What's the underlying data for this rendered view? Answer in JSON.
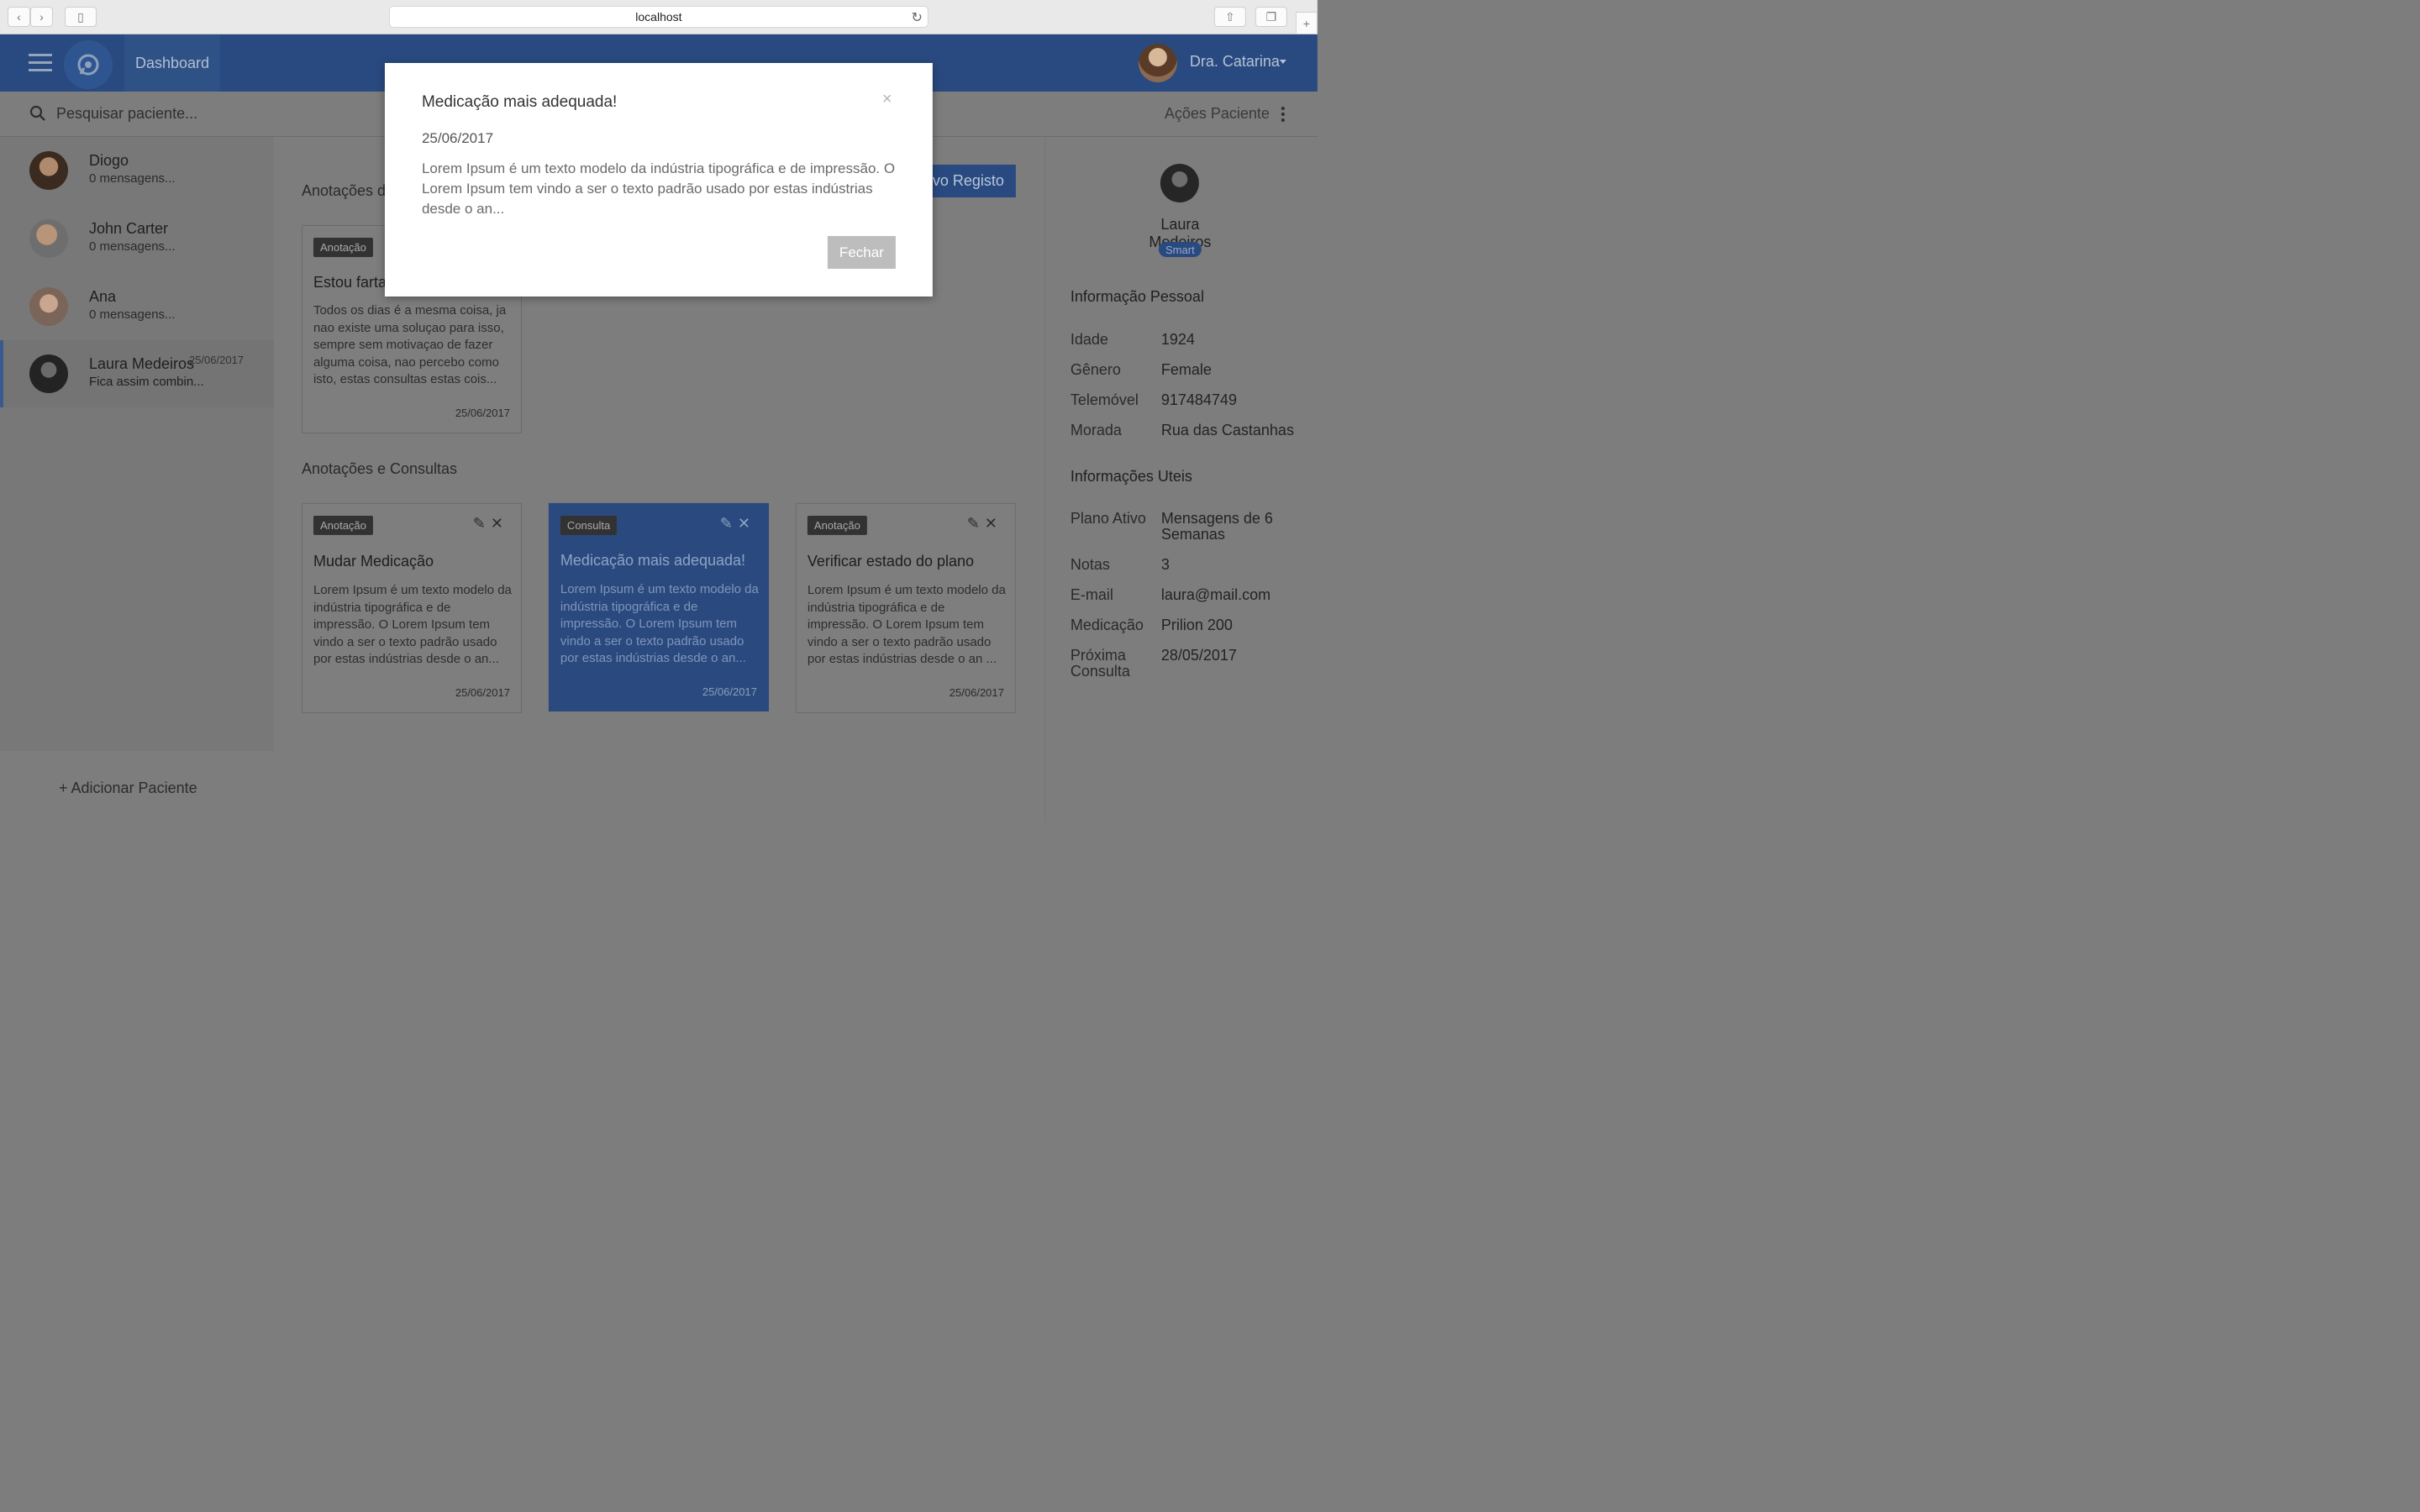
{
  "browser": {
    "url": "localhost"
  },
  "header": {
    "dashboard_label": "Dashboard",
    "user_name": "Dra. Catarina"
  },
  "search": {
    "placeholder": "Pesquisar paciente...",
    "actions_label": "Ações Paciente"
  },
  "patients": [
    {
      "name": "Diogo",
      "message": "0 mensagens...",
      "date": ""
    },
    {
      "name": "John Carter",
      "message": "0 mensagens...",
      "date": ""
    },
    {
      "name": "Ana",
      "message": "0 mensagens...",
      "date": ""
    },
    {
      "name": "Laura Medeiros",
      "message": "Fica assim combin...",
      "date": "25/06/2017"
    }
  ],
  "add_patient_label": "Adicionar Paciente",
  "main": {
    "pinned_title": "Anotações d",
    "new_record_label": "ovo Registo",
    "pinned_card": {
      "badge": "Anotação",
      "title": "Estou farta",
      "body": "Todos os dias é a mesma coisa, ja nao existe uma soluçao para isso, sempre sem motivaçao de fazer alguma coisa, nao percebo como isto, estas consultas estas cois...",
      "date": "25/06/2017"
    },
    "section_title": "Anotações e Consultas",
    "cards": [
      {
        "badge": "Anotação",
        "title": "Mudar Medicação",
        "body": "Lorem Ipsum é um texto modelo da indústria tipográfica e de impressão. O Lorem Ipsum tem vindo a ser o texto padrão usado por estas indústrias desde o an...",
        "date": "25/06/2017"
      },
      {
        "badge": "Consulta",
        "title": "Medicação mais adequada!",
        "body": "Lorem Ipsum é um texto modelo da indústria tipográfica e de impressão. O Lorem Ipsum tem vindo a ser o texto padrão usado por estas indústrias desde o an...",
        "date": "25/06/2017"
      },
      {
        "badge": "Anotação",
        "title": "Verificar estado do plano",
        "body": "Lorem Ipsum é um texto modelo da indústria tipográfica e de impressão. O Lorem Ipsum tem vindo a ser o texto padrão usado por estas indústrias desde o an ...",
        "date": "25/06/2017"
      }
    ]
  },
  "profile": {
    "name": "Laura Medeiros",
    "tag": "Smart",
    "personal_title": "Informação Pessoal",
    "personal": [
      {
        "key": "Idade",
        "value": "1924"
      },
      {
        "key": "Gênero",
        "value": "Female"
      },
      {
        "key": "Telemóvel",
        "value": "917484749"
      },
      {
        "key": "Morada",
        "value": "Rua das Castanhas"
      }
    ],
    "useful_title": "Informações Uteis",
    "useful": [
      {
        "key": "Plano Ativo",
        "value": "Mensagens de 6 Semanas"
      },
      {
        "key": "Notas",
        "value": "3"
      },
      {
        "key": "E-mail",
        "value": "laura@mail.com"
      },
      {
        "key": "Medicação",
        "value": "Prilion 200"
      },
      {
        "key": "Próxima Consulta",
        "value": "28/05/2017"
      }
    ]
  },
  "modal": {
    "title": "Medicação mais adequada!",
    "date": "25/06/2017",
    "body": "Lorem Ipsum é um texto modelo da indústria tipográfica e de impressão. O Lorem Ipsum tem vindo a ser o texto padrão usado por estas indústrias desde o an...",
    "close_label": "Fechar",
    "close_icon": "×"
  },
  "colors": {
    "header": "#294a80",
    "overlay": "#7d7d7d",
    "accent": "#3a5a8f"
  }
}
